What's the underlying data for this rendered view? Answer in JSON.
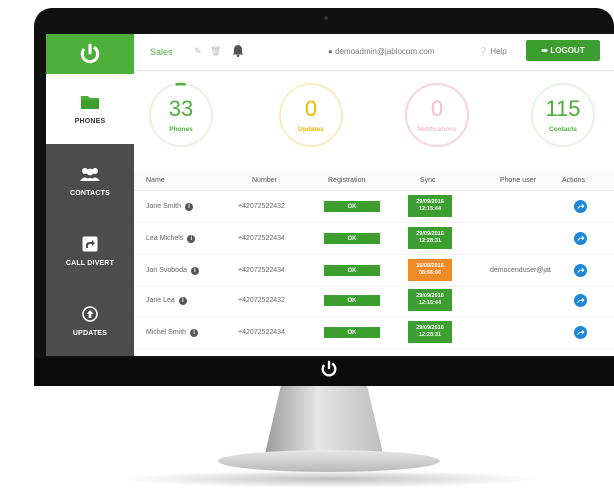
{
  "colors": {
    "brand_green": "#4caf3a",
    "sync_warning": "#f08a24",
    "action_blue": "#1e88d6"
  },
  "header": {
    "group": "Sales",
    "user": "demoadmin@jablocom.com",
    "help": "Help",
    "logout": "LOGOUT",
    "icons": [
      "pencil-icon",
      "trash-icon",
      "bell-icon",
      "user-icon",
      "help-icon",
      "logout-icon"
    ]
  },
  "sidebar": {
    "items": [
      {
        "label": "PHONES",
        "icon": "folder-icon",
        "active": true
      },
      {
        "label": "CONTACTS",
        "icon": "people-icon",
        "active": false
      },
      {
        "label": "CALL DIVERT",
        "icon": "divert-icon",
        "active": false
      },
      {
        "label": "UPDATES",
        "icon": "upload-icon",
        "active": false
      }
    ]
  },
  "stats": [
    {
      "value": "33",
      "label": "Phones",
      "color": "#4caf3a",
      "progress": 0.05
    },
    {
      "value": "0",
      "label": "Updates",
      "color": "#f0b400",
      "progress": 0
    },
    {
      "value": "0",
      "label": "Notifications",
      "color": "#e8708a",
      "progress": 0
    },
    {
      "value": "115",
      "label": "Contacts",
      "color": "#4caf3a",
      "progress": 0
    }
  ],
  "table": {
    "columns": [
      "Name",
      "Number",
      "Registration",
      "Sync",
      "Phone user",
      "Actions"
    ],
    "rows": [
      {
        "name": "Jane Smith",
        "number": "+42072522432",
        "registration": "OK",
        "sync_date": "29/09/2016",
        "sync_time": "12:15:44",
        "sync_status": "ok",
        "phone_user": ""
      },
      {
        "name": "Lea Michels",
        "number": "+42072522434",
        "registration": "OK",
        "sync_date": "29/09/2016",
        "sync_time": "12:28:31",
        "sync_status": "ok",
        "phone_user": ""
      },
      {
        "name": "Jan Svoboda",
        "number": "+42072522434",
        "registration": "OK",
        "sync_date": "16/09/2016",
        "sync_time": "08:56:06",
        "sync_status": "warning",
        "phone_user": "democenduser@jat"
      },
      {
        "name": "Jane Lea",
        "number": "+42072522432",
        "registration": "OK",
        "sync_date": "29/09/2016",
        "sync_time": "12:15:44",
        "sync_status": "ok",
        "phone_user": ""
      },
      {
        "name": "Michel Smith",
        "number": "+42072522434",
        "registration": "OK",
        "sync_date": "29/09/2016",
        "sync_time": "12:28:31",
        "sync_status": "ok",
        "phone_user": ""
      }
    ]
  }
}
